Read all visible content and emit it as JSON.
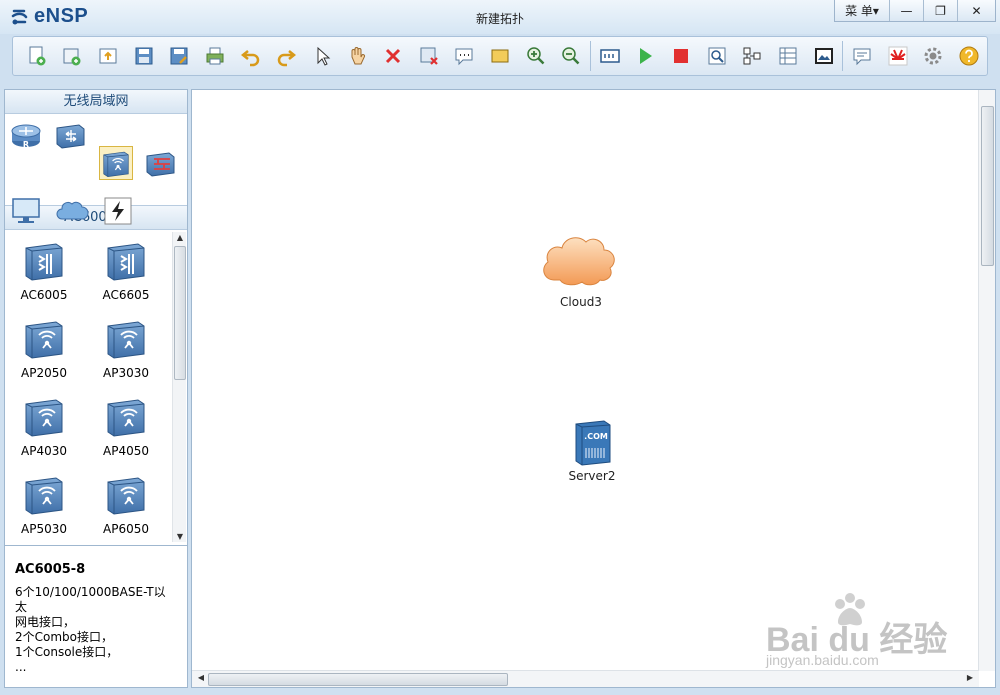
{
  "app": {
    "name": "eNSP",
    "window_title": "新建拓扑",
    "menu_label": "菜 单▾",
    "minimize": "—",
    "maximize": "❐",
    "close": "✕"
  },
  "toolbar": {
    "items": [
      "new-topology",
      "new-from-template",
      "open",
      "save",
      "save-as",
      "print",
      "undo",
      "redo",
      "select",
      "pan",
      "delete",
      "delete-link",
      "text-note",
      "rectangle",
      "zoom-in",
      "zoom-out",
      "fit",
      "start-device",
      "stop-device",
      "capture-data",
      "topology-layout",
      "show-grid",
      "screenshot",
      "forum",
      "huawei-site",
      "settings",
      "help"
    ]
  },
  "left_panel": {
    "category_title": "无线局域网",
    "categories": [
      "router",
      "switch",
      "wlan",
      "firewall",
      "pc",
      "cloud",
      "connection"
    ],
    "selected_category": "wlan",
    "device_title": "AC6005-8",
    "devices": [
      {
        "name": "AC6005",
        "kind": "ac"
      },
      {
        "name": "AC6605",
        "kind": "ac"
      },
      {
        "name": "AP2050",
        "kind": "ap"
      },
      {
        "name": "AP3030",
        "kind": "ap"
      },
      {
        "name": "AP4030",
        "kind": "ap"
      },
      {
        "name": "AP4050",
        "kind": "ap"
      },
      {
        "name": "AP5030",
        "kind": "ap"
      },
      {
        "name": "AP6050",
        "kind": "ap"
      }
    ],
    "info": {
      "title": "AC6005-8",
      "lines": [
        "6个10/100/1000BASE-T以太",
        "网电接口，",
        "2个Combo接口，",
        "1个Console接口，",
        "..."
      ]
    }
  },
  "canvas": {
    "nodes": [
      {
        "label": "Cloud3",
        "icon": "cloud-icon"
      },
      {
        "label": "Server2",
        "icon": "server-icon",
        "icon_text": ".COM"
      }
    ]
  },
  "watermark": {
    "brand": "Bai du 经验",
    "url": "jingyan.baidu.com"
  },
  "colors": {
    "accent": "#1c4f8c",
    "panel_header": "#d7e5f2",
    "cloud": "#f5a463",
    "server": "#3a78b8"
  }
}
